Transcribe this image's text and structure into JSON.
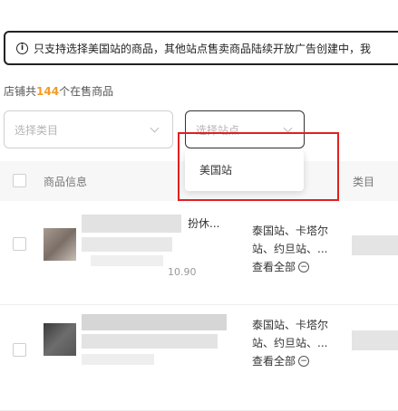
{
  "notice": {
    "text": "只支持选择美国站的商品，其他站点售卖商品陆续开放广告创建中，我"
  },
  "count_line": {
    "prefix": "店铺共",
    "count": "144",
    "suffix": "个在售商品"
  },
  "filters": {
    "category_placeholder": "选择类目",
    "site_placeholder": "选择站点"
  },
  "dropdown": {
    "options": [
      "美国站"
    ]
  },
  "table": {
    "headers": {
      "product": "商品信息",
      "category": "类目"
    },
    "rows": [
      {
        "title_fragment": "扮休...",
        "price_fragment": "10.90",
        "sites_line1": "泰国站、卡塔尔",
        "sites_line2": "站、约旦站、...",
        "view_all": "查看全部"
      },
      {
        "sites_line1": "泰国站、卡塔尔",
        "sites_line2": "站、约旦站、...",
        "view_all": "查看全部"
      }
    ]
  },
  "colors": {
    "count_accent": "#f59a23",
    "annotation_red": "#e02020"
  }
}
